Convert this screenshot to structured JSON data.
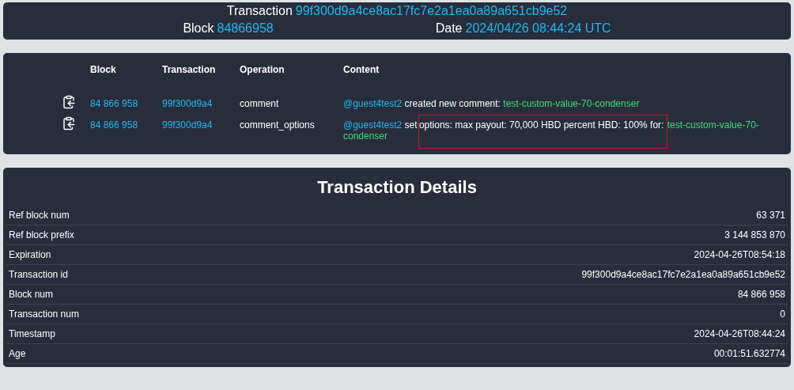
{
  "header": {
    "transaction_label": "Transaction",
    "transaction": "99f300d9a4ce8ac17fc7e2a1ea0a89a651cb9e52",
    "block_label": "Block",
    "block": "84866958",
    "date_label": "Date",
    "date": "2024/04/26 08:44:24 UTC"
  },
  "operations": {
    "columns": [
      "Block",
      "Transaction",
      "Operation",
      "Content"
    ],
    "rows": [
      {
        "block": "84 866 958",
        "transaction": "99f300d9a4",
        "operation": "comment",
        "content": [
          {
            "kind": "user",
            "text": "@guest4test2",
            "highlighted": false
          },
          {
            "kind": "text",
            "text": " created new comment: ",
            "highlighted": false
          },
          {
            "kind": "link",
            "text": "test-custom-value-70-condenser",
            "highlighted": false
          }
        ]
      },
      {
        "block": "84 866 958",
        "transaction": "99f300d9a4",
        "operation": "comment_options",
        "content": [
          {
            "kind": "user",
            "text": "@guest4test2",
            "highlighted": false
          },
          {
            "kind": "text",
            "text": " set ",
            "highlighted": false
          },
          {
            "kind": "text",
            "text": "options: max payout: 70,000 HBD percent HBD: 100% for: ",
            "highlighted": true
          },
          {
            "kind": "link",
            "text": "test-custom-value-70-condenser",
            "highlighted": false
          }
        ]
      }
    ]
  },
  "details": {
    "title": "Transaction Details",
    "rows": [
      {
        "label": "Ref block num",
        "value": "63 371"
      },
      {
        "label": "Ref block prefix",
        "value": "3 144 853 870"
      },
      {
        "label": "Expiration",
        "value": "2024-04-26T08:54:18"
      },
      {
        "label": "Transaction id",
        "value": "99f300d9a4ce8ac17fc7e2a1ea0a89a651cb9e52"
      },
      {
        "label": "Block num",
        "value": "84 866 958"
      },
      {
        "label": "Transaction num",
        "value": "0"
      },
      {
        "label": "Timestamp",
        "value": "2024-04-26T08:44:24"
      },
      {
        "label": "Age",
        "value": "00:01:51.632774"
      }
    ]
  }
}
